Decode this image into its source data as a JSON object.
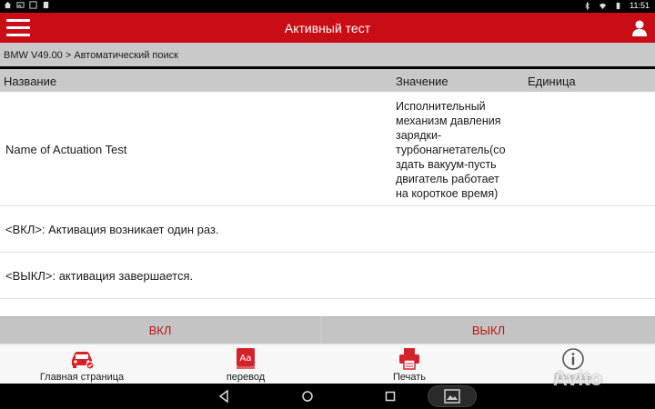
{
  "statusbar": {
    "time": "11:51",
    "left_icons": [
      "home-icon",
      "image-icon",
      "screenshot-icon",
      "notification-icon"
    ],
    "right_icons": [
      "bluetooth-icon",
      "wifi-icon",
      "battery-icon"
    ]
  },
  "appbar": {
    "title": "Активный тест",
    "menu_icon": "hamburger-menu-icon",
    "user_icon": "user-icon"
  },
  "breadcrumb": "BMW V49.00 > Автоматический поиск",
  "table": {
    "columns": [
      "Название",
      "Значение",
      "Единица"
    ],
    "rows": [
      {
        "name": "Name of Actuation Test",
        "value_lines": [
          "Исполнительный",
          "механизм давления",
          "зарядки-",
          "турбонагнетатель(со",
          "здать вакуум-пусть",
          "двигатель работает",
          "на короткое время)"
        ],
        "unit": ""
      },
      {
        "name": "<ВКЛ>: Активация возникает один раз.",
        "value_lines": [],
        "unit": ""
      },
      {
        "name": "<ВЫКЛ>: активация завершается.",
        "value_lines": [],
        "unit": ""
      }
    ]
  },
  "actions": {
    "on": "ВКЛ",
    "off": "ВЫКЛ"
  },
  "bottom_nav": [
    {
      "label": "Главная страница",
      "icon": "car-home-icon",
      "enabled": true
    },
    {
      "label": "перевод",
      "icon": "translate-icon",
      "enabled": true
    },
    {
      "label": "Печать",
      "icon": "printer-icon",
      "enabled": true
    },
    {
      "label": "Помощь",
      "icon": "info-icon",
      "enabled": false
    }
  ],
  "watermark": "Avito",
  "colors": {
    "accent": "#c80d15",
    "action_text": "#c0141b",
    "header_gray": "#c9c9c9"
  }
}
